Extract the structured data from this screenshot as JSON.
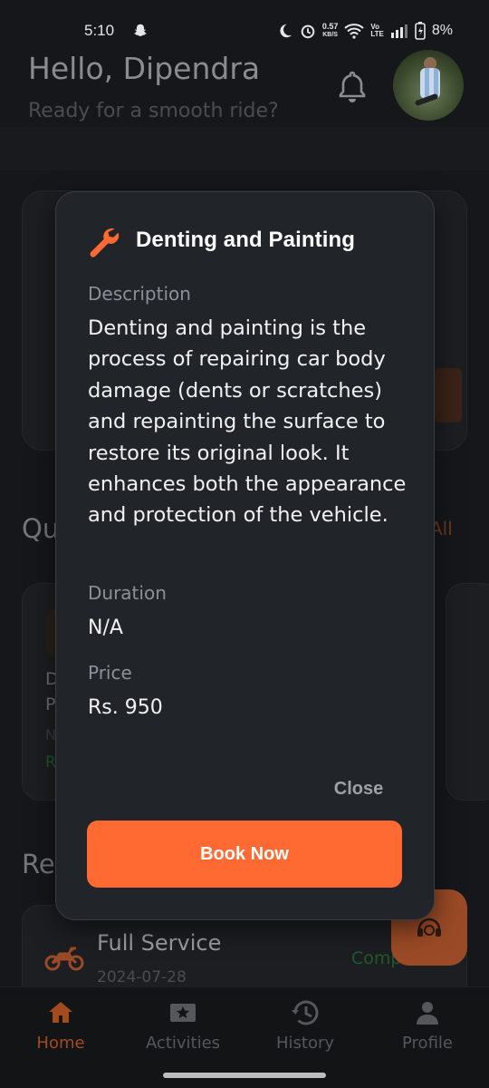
{
  "status_bar": {
    "time": "5:10",
    "net_speed_top": "0.57",
    "net_speed_bottom": "KB/S",
    "volte_top": "Vo",
    "volte_bottom": "LTE",
    "battery": "8%"
  },
  "header": {
    "greeting": "Hello, Dipendra",
    "subtitle": "Ready for a smooth ride?"
  },
  "background": {
    "quick_services_fragment": "Qu",
    "see_all_fragment": "All",
    "card_fragments": [
      "D",
      "P",
      "N",
      "R"
    ],
    "recent_fragment": "Re",
    "recent_item": {
      "title": "Full Service",
      "date": "2024-07-28",
      "status": "Comp"
    }
  },
  "dialog": {
    "title": "Denting and Painting",
    "description_label": "Description",
    "description": "Denting and painting is the process of repairing car body damage (dents or scratches) and repainting the surface to restore its original look. It enhances both the appearance and protection of the vehicle.",
    "duration_label": "Duration",
    "duration": "N/A",
    "price_label": "Price",
    "price": "Rs. 950",
    "close_label": "Close",
    "book_label": "Book Now"
  },
  "nav": {
    "items": [
      {
        "label": "Home",
        "icon": "home-icon",
        "active": true
      },
      {
        "label": "Activities",
        "icon": "star-ticket-icon",
        "active": false
      },
      {
        "label": "History",
        "icon": "history-icon",
        "active": false
      },
      {
        "label": "Profile",
        "icon": "person-icon",
        "active": false
      }
    ]
  },
  "colors": {
    "accent": "#ff6a33",
    "dialog_bg": "#212429",
    "background": "#15171a"
  }
}
